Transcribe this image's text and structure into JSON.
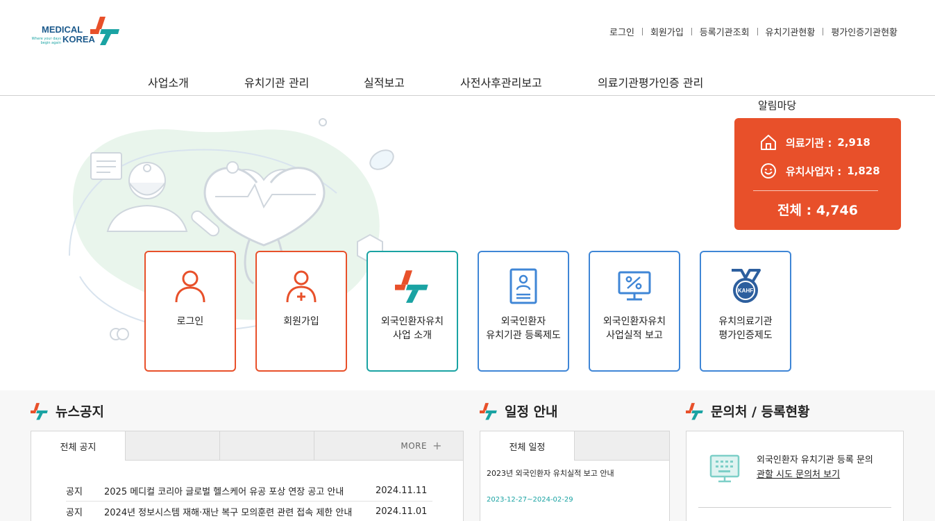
{
  "logo": {
    "line1": "MEDICAL",
    "line2": "KOREA",
    "tagline": "Where your days begin again"
  },
  "util_menu": [
    "로그인",
    "회원가입",
    "등록기관조회",
    "유치기관현황",
    "평가인증기관현황"
  ],
  "gnb": [
    "사업소개",
    "유치기관 관리",
    "실적보고",
    "사전사후관리보고",
    "의료기관평가인증 관리"
  ],
  "notice_label": "알림마당",
  "stats": {
    "hospitals_label": "의료기관 :",
    "hospitals_value": "2,918",
    "agencies_label": "유치사업자 :",
    "agencies_value": "1,828",
    "total_label": "전체 :",
    "total_value": "4,746"
  },
  "quick_menu": [
    {
      "label": "로그인",
      "icon": "user-icon"
    },
    {
      "label": "회원가입",
      "icon": "user-plus-icon"
    },
    {
      "label": "외국인환자유치\n사업 소개",
      "icon": "medical-korea-mark-icon"
    },
    {
      "label": "외국인환자\n유치기관 등록제도",
      "icon": "id-card-icon"
    },
    {
      "label": "외국인환자유치\n사업실적 보고",
      "icon": "monitor-percent-icon"
    },
    {
      "label": "유치의료기관\n평가인증제도",
      "icon": "kahf-medal-icon"
    }
  ],
  "kahf_text": "KAHF",
  "news": {
    "title": "뉴스공지",
    "tabs": [
      "전체 공지",
      "",
      ""
    ],
    "more_label": "MORE",
    "items": [
      {
        "category": "공지",
        "title": "2025 메디컬 코리아 글로벌 헬스케어 유공 포상 연장 공고 안내",
        "date": "2024.11.11"
      },
      {
        "category": "공지",
        "title": "2024년 정보시스템 재해·재난 복구 모의훈련 관련 접속 제한 안내",
        "date": "2024.11.01"
      }
    ]
  },
  "schedule": {
    "title": "일정 안내",
    "tab": "전체 일정",
    "item_title": "2023년 외국인환자 유치실적 보고 안내",
    "item_date": "2023-12-27~2024-02-29"
  },
  "contact": {
    "title": "문의처 / 등록현황",
    "text": "외국인환자 유치기관 등록 문의",
    "link": "관할 시도 문의처 보기"
  },
  "colors": {
    "accent_orange": "#e8502a",
    "accent_teal": "#1aa3a3",
    "accent_blue": "#3f86d6",
    "brand_navy": "#1c5a8c"
  }
}
